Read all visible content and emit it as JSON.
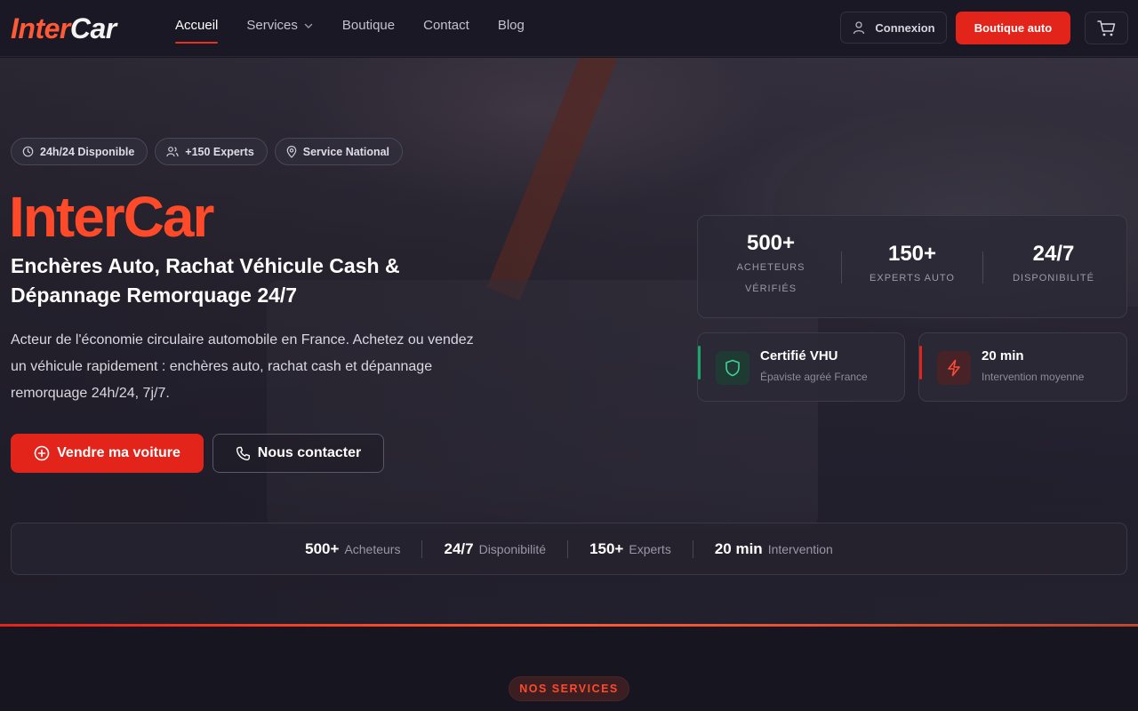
{
  "nav": {
    "logo_part1": "Inter",
    "logo_part2": "Car",
    "links": [
      "Accueil",
      "Services",
      "Boutique",
      "Contact",
      "Blog"
    ],
    "login_label": "Connexion",
    "shop_label": "Boutique auto"
  },
  "hero": {
    "chips": [
      "24h/24 Disponible",
      "+150 Experts",
      "Service National"
    ],
    "title": "InterCar",
    "subtitle": "Enchères Auto, Rachat Véhicule Cash & Dépannage Remorquage 24/7",
    "description": "Acteur de l'économie circulaire automobile en France. Achetez ou vendez un véhicule rapidement : enchères auto, rachat cash et dépannage remorquage 24h/24, 7j/7.",
    "sell_label": "Vendre ma voiture",
    "contact_label": "Nous contacter"
  },
  "stats_card": [
    {
      "num": "500+",
      "label": "Acheteurs vérifiés"
    },
    {
      "num": "150+",
      "label": "Experts auto"
    },
    {
      "num": "24/7",
      "label": "Disponibilité"
    }
  ],
  "mini_cards": [
    {
      "title": "Certifié VHU",
      "sub": "Épaviste agréé France",
      "accent": "#19a86b",
      "icon": "shield-icon"
    },
    {
      "title": "20 min",
      "sub": "Intervention moyenne",
      "accent": "#e3241a",
      "icon": "bolt-icon"
    }
  ],
  "strip": [
    {
      "num": "500+",
      "label": "Acheteurs"
    },
    {
      "num": "24/7",
      "label": "Disponibilité"
    },
    {
      "num": "150+",
      "label": "Experts"
    },
    {
      "num": "20 min",
      "label": "Intervention"
    }
  ],
  "section_badge": "NOS SERVICES",
  "colors": {
    "accent": "#e3241a",
    "brand": "#ff4a2a",
    "background": "#17151f"
  }
}
